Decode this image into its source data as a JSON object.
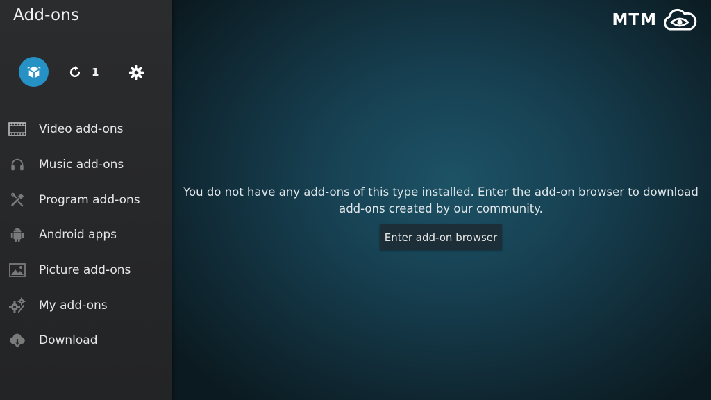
{
  "header": {
    "title": "Add-ons",
    "logo_text": "MTM"
  },
  "toolbar": {
    "updates_count": "1"
  },
  "sidebar": {
    "items": [
      {
        "label": "Video add-ons",
        "icon": "film-icon"
      },
      {
        "label": "Music add-ons",
        "icon": "headphones-icon"
      },
      {
        "label": "Program add-ons",
        "icon": "tools-icon"
      },
      {
        "label": "Android apps",
        "icon": "android-icon"
      },
      {
        "label": "Picture add-ons",
        "icon": "picture-icon"
      },
      {
        "label": "My add-ons",
        "icon": "gears-icon"
      },
      {
        "label": "Download",
        "icon": "cloud-download-icon"
      }
    ]
  },
  "main": {
    "empty_message": "You do not have any add-ons of this type installed. Enter the add-on browser to download add-ons created by our community.",
    "browser_button_label": "Enter add-on browser"
  },
  "colors": {
    "accent": "#2591c5",
    "sidebar_bg": "#28292b",
    "main_bg": "#174254"
  }
}
